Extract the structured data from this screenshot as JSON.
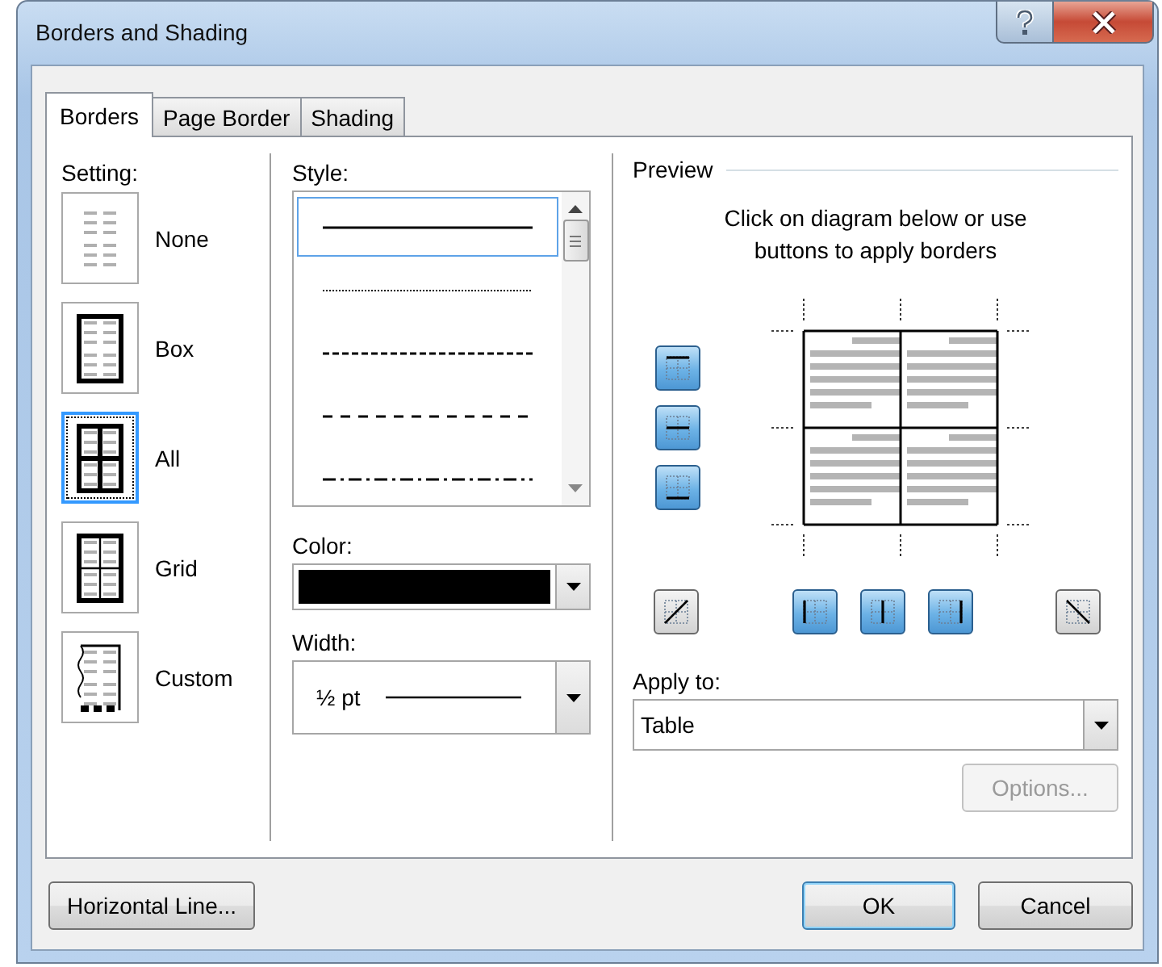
{
  "window": {
    "title": "Borders and Shading"
  },
  "tabs": [
    {
      "label": "Borders",
      "selected": true
    },
    {
      "label": "Page Border",
      "selected": false
    },
    {
      "label": "Shading",
      "selected": false
    }
  ],
  "setting": {
    "label": "Setting:",
    "options": [
      {
        "kind": "none",
        "label": "None",
        "selected": false
      },
      {
        "kind": "box",
        "label": "Box",
        "selected": false
      },
      {
        "kind": "all",
        "label": "All",
        "selected": true
      },
      {
        "kind": "grid",
        "label": "Grid",
        "selected": false
      },
      {
        "kind": "custom",
        "label": "Custom",
        "selected": false
      }
    ]
  },
  "style": {
    "label": "Style:",
    "options": [
      {
        "kind": "solid",
        "selected": true
      },
      {
        "kind": "dotted",
        "selected": false
      },
      {
        "kind": "dashed",
        "selected": false
      },
      {
        "kind": "dashed-wide",
        "selected": false
      },
      {
        "kind": "dash-dot",
        "selected": false
      }
    ]
  },
  "color": {
    "label": "Color:",
    "color": "#000000"
  },
  "width": {
    "label": "Width:",
    "value": "½ pt"
  },
  "preview": {
    "title": "Preview",
    "hint": "Click on diagram below or use buttons to apply borders",
    "side_buttons": [
      {
        "kind": "top",
        "on": true
      },
      {
        "kind": "inside-h",
        "on": true
      },
      {
        "kind": "bottom",
        "on": true
      }
    ],
    "bottom_buttons": [
      {
        "kind": "diag-up",
        "on": false
      },
      {
        "kind": "left",
        "on": true
      },
      {
        "kind": "inside-v",
        "on": true
      },
      {
        "kind": "right",
        "on": true
      },
      {
        "kind": "diag-down",
        "on": false
      }
    ]
  },
  "apply_to": {
    "label": "Apply to:",
    "value": "Table"
  },
  "options_button": {
    "label": "Options...",
    "disabled": true
  },
  "footer": {
    "left_button": "Horizontal Line...",
    "ok": "OK",
    "cancel": "Cancel"
  }
}
